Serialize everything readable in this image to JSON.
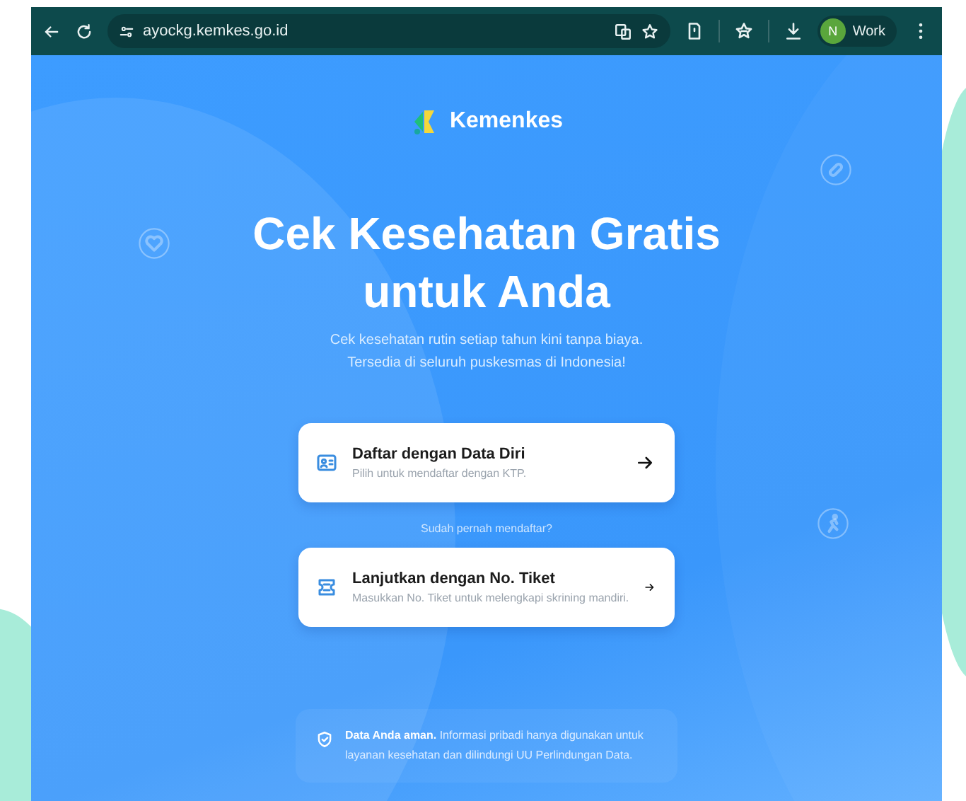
{
  "browser": {
    "url": "ayockg.kemkes.go.id",
    "profile_initial": "N",
    "profile_label": "Work"
  },
  "logo": {
    "text": "Kemenkes"
  },
  "hero": {
    "title": [
      "Cek Kesehatan Gratis",
      "untuk Anda"
    ],
    "subtitle": "Cek kesehatan rutin setiap tahun kini tanpa biaya. Tersedia di seluruh puskesmas di Indonesia!"
  },
  "options": [
    {
      "kind": "id-card",
      "title": "Daftar dengan Data Diri",
      "subtitle": "Pilih untuk mendaftar dengan KTP."
    },
    {
      "kind": "ticket",
      "title": "Lanjutkan dengan No. Tiket",
      "subtitle": "Masukkan No. Tiket untuk melengkapi skrining mandiri."
    }
  ],
  "divider_text": "Sudah pernah mendaftar?",
  "notice": "**Data Anda aman.** Informasi pribadi hanya digunakan untuk layanan kesehatan dan dilindungi UU Perlindungan Data."
}
